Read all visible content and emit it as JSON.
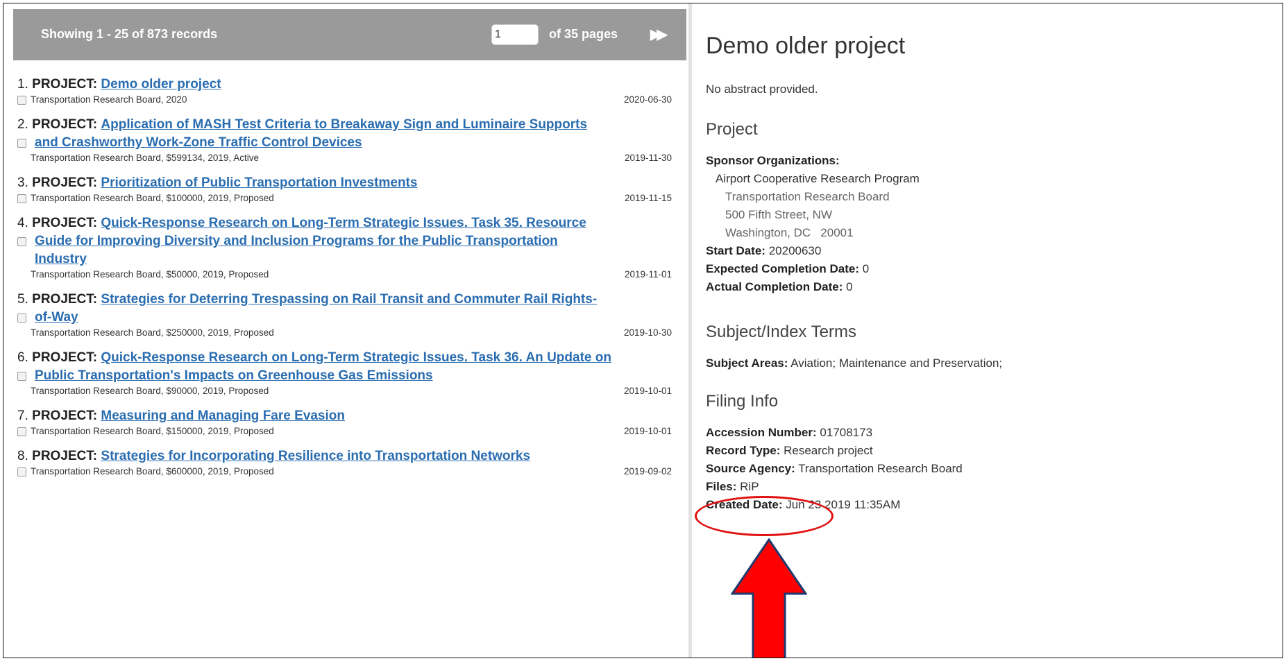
{
  "header": {
    "showing": "Showing 1 - 25 of 873 records",
    "page_input_value": "1",
    "pages_label": "of 35 pages",
    "next_icon": "fast-forward-icon"
  },
  "results": [
    {
      "num": "1.",
      "label": "PROJECT:",
      "title_lines": [
        "Demo older project"
      ],
      "meta": "Transportation Research Board, 2020",
      "date": "2020-06-30"
    },
    {
      "num": "2.",
      "label": "PROJECT:",
      "title_lines": [
        "Application of MASH Test Criteria to Breakaway Sign and Luminaire Supports",
        "and Crashworthy Work-Zone Traffic Control Devices"
      ],
      "meta": "Transportation Research Board, $599134, 2019, Active",
      "date": "2019-11-30"
    },
    {
      "num": "3.",
      "label": "PROJECT:",
      "title_lines": [
        "Prioritization of Public Transportation Investments"
      ],
      "meta": "Transportation Research Board, $100000, 2019, Proposed",
      "date": "2019-11-15"
    },
    {
      "num": "4.",
      "label": "PROJECT:",
      "title_lines": [
        "Quick-Response Research on Long-Term Strategic Issues. Task 35. Resource",
        "Guide for Improving Diversity and Inclusion Programs for the Public Transportation",
        "Industry"
      ],
      "meta": "Transportation Research Board, $50000, 2019, Proposed",
      "date": "2019-11-01"
    },
    {
      "num": "5.",
      "label": "PROJECT:",
      "title_lines": [
        "Strategies for Deterring Trespassing on Rail Transit and Commuter Rail Rights-",
        "of-Way"
      ],
      "meta": "Transportation Research Board, $250000, 2019, Proposed",
      "date": "2019-10-30"
    },
    {
      "num": "6.",
      "label": "PROJECT:",
      "title_lines": [
        "Quick-Response Research on Long-Term Strategic Issues. Task 36. An Update on",
        "Public Transportation's Impacts on Greenhouse Gas Emissions"
      ],
      "meta": "Transportation Research Board, $90000, 2019, Proposed",
      "date": "2019-10-01"
    },
    {
      "num": "7.",
      "label": "PROJECT:",
      "title_lines": [
        "Measuring and Managing Fare Evasion"
      ],
      "meta": "Transportation Research Board, $150000, 2019, Proposed",
      "date": "2019-10-01"
    },
    {
      "num": "8.",
      "label": "PROJECT:",
      "title_lines": [
        "Strategies for Incorporating Resilience into Transportation Networks"
      ],
      "meta": "Transportation Research Board, $600000, 2019, Proposed",
      "date": "2019-09-02"
    }
  ],
  "detail": {
    "title": "Demo older project",
    "abstract": "No abstract provided.",
    "project_heading": "Project",
    "sponsor_label": "Sponsor Organizations:",
    "sponsor_name": "Airport Cooperative Research Program",
    "sponsor_org": "Transportation Research Board",
    "sponsor_street": "500 Fifth Street, NW",
    "sponsor_city": "Washington, DC   20001",
    "start_label": "Start Date:",
    "start_value": "20200630",
    "expected_label": "Expected Completion Date:",
    "expected_value": "0",
    "actual_label": "Actual Completion Date:",
    "actual_value": "0",
    "subject_heading": "Subject/Index Terms",
    "subject_label": "Subject Areas:",
    "subject_value": "Aviation; Maintenance and Preservation;",
    "filing_heading": "Filing Info",
    "accession_label": "Accession Number:",
    "accession_value": "01708173",
    "record_label": "Record Type:",
    "record_value": "Research project",
    "source_label": "Source Agency:",
    "source_value": "Transportation Research Board",
    "files_label": "Files:",
    "files_value": "RiP",
    "created_label": "Created Date:",
    "created_value": "Jun 23 2019 11:35AM"
  },
  "annotation": {
    "callout_color": "#e11111",
    "arrow_color": "#ff0000",
    "arrow_outline": "#1f3a6e"
  }
}
